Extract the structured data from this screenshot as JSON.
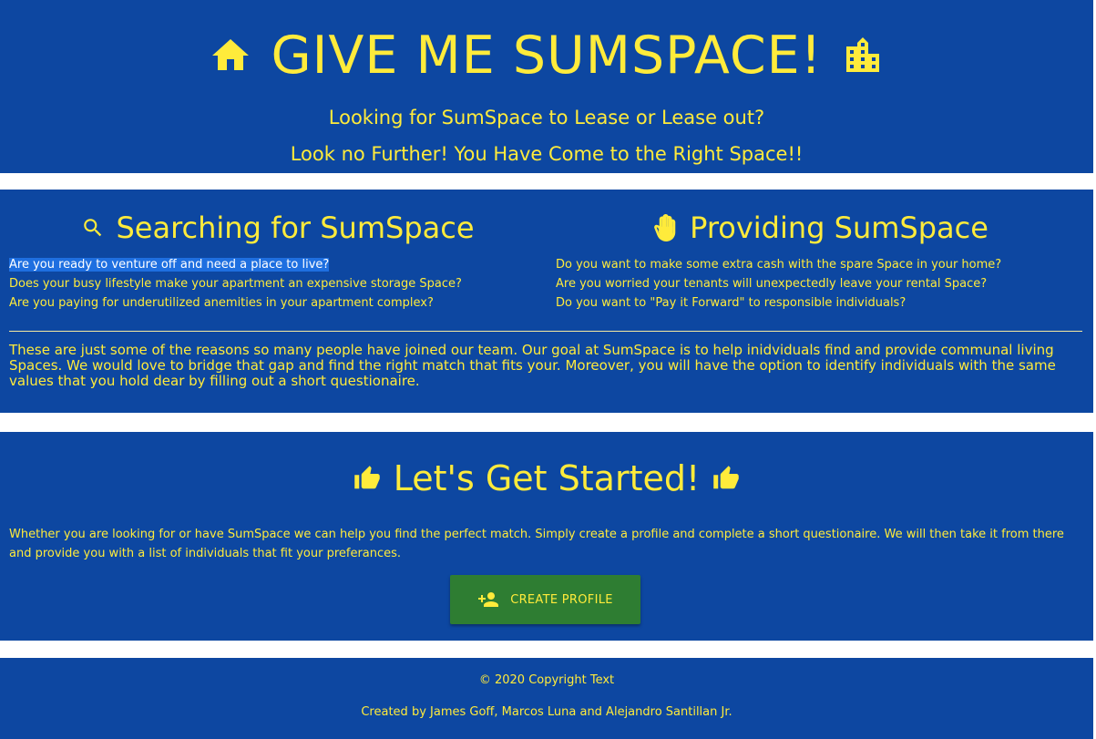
{
  "hero": {
    "title": "GIVE ME SUMSPACE!",
    "subtitle1": "Looking for SumSpace to Lease or Lease out?",
    "subtitle2": "Look no Further! You Have Come to the Right Space!!",
    "icons": [
      "home-icon",
      "building-icon"
    ]
  },
  "searching": {
    "heading": "Searching for SumSpace",
    "icon": "search-icon",
    "questions": [
      "Are you ready to venture off and need a place to live?",
      "Does your busy lifestyle make your apartment an expensive storage Space?",
      "Are you paying for underutilized anemities in your apartment complex?"
    ]
  },
  "providing": {
    "heading": "Providing SumSpace",
    "icon": "hand-icon",
    "questions": [
      "Do you want to make some extra cash with the spare Space in your home?",
      "Are you worried your tenants will unexpectedly leave your rental Space?",
      "Do you want to \"Pay it Forward\" to responsible individuals?"
    ]
  },
  "reasons_text": "These are just some of the reasons so many people have joined our team. Our goal at SumSpace is to help inidviduals find and provide communal living Spaces. We would love to bridge that gap and find the right match that fits your. Moreover, you will have the option to identify individuals with the same values that you hold dear by filling out a short questionaire.",
  "started": {
    "heading": "Let's Get Started!",
    "icon": "thumbs-up-icon",
    "text": "Whether you are looking for or have SumSpace we can help you find the perfect match. Simply create a profile and complete a short questionaire. We will then take it from there and provide you with a list of individuals that fit your preferances.",
    "button_label": "CREATE PROFILE",
    "button_icon": "person-add-icon"
  },
  "footer": {
    "copyright": "© 2020 Copyright Text",
    "credits": "Created by James Goff, Marcos Luna and Alejandro Santillan Jr."
  },
  "colors": {
    "band": "#0d47a1",
    "text": "#ffeb3b",
    "button": "#2e7d32",
    "selection": "#1e6fe0"
  }
}
